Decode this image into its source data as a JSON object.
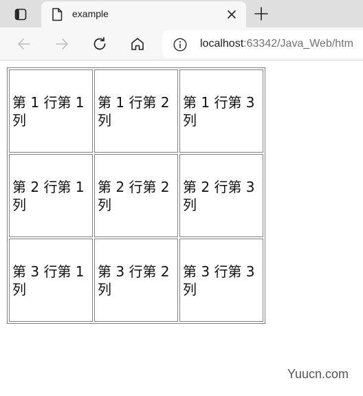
{
  "tab": {
    "title": "example"
  },
  "address": {
    "host": "localhost",
    "rest": ":63342/Java_Web/htm"
  },
  "table": {
    "rows": [
      [
        "第 1 行第 1 列",
        "第 1 行第 2 列",
        "第 1 行第 3 列"
      ],
      [
        "第 2 行第 1 列",
        "第 2 行第 2 列",
        "第 2 行第 3 列"
      ],
      [
        "第 3 行第 1 列",
        "第 3 行第 2 列",
        "第 3 行第 3 列"
      ]
    ]
  },
  "watermark": "Yuucn.com",
  "icons": {
    "tab_actions": "tab-actions-icon",
    "favicon": "document-icon",
    "close": "close-icon",
    "new_tab": "plus-icon",
    "back": "back-arrow-icon",
    "forward": "forward-arrow-icon",
    "refresh": "refresh-icon",
    "home": "home-icon",
    "site_info": "info-icon"
  },
  "colors": {
    "tabstrip": "#dfdfdf",
    "toolbar": "#f7f7f7",
    "cell_border": "#808080"
  }
}
